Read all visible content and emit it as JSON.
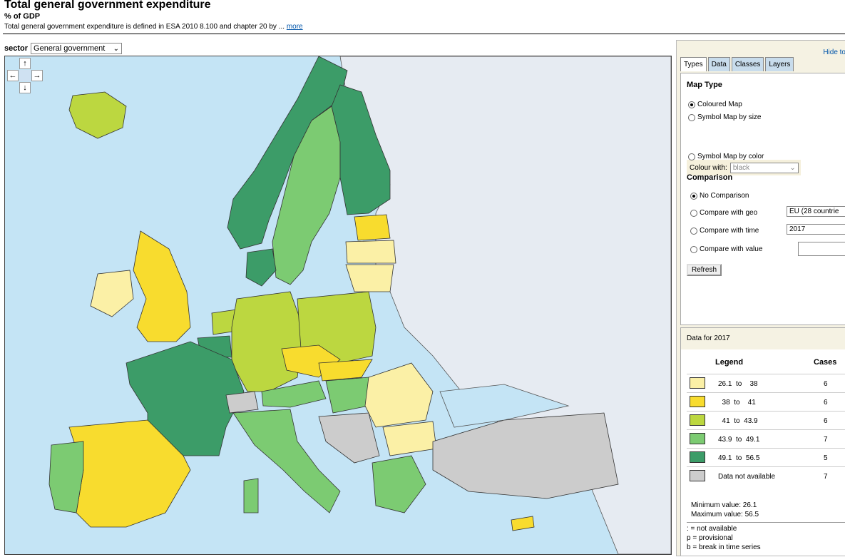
{
  "header": {
    "title": "Total general government expenditure",
    "unit": "% of GDP",
    "definition": "Total general government expenditure is defined in ESA 2010 8.100 and chapter 20 by ...",
    "more_link": "more"
  },
  "filter": {
    "label": "sector",
    "selected": "General government"
  },
  "map_nav": {
    "up": "↑",
    "down": "↓",
    "left": "←",
    "right": "→"
  },
  "sidepanel": {
    "hide_link": "Hide to",
    "tabs": [
      "Types",
      "Data",
      "Classes",
      "Layers"
    ],
    "active_tab": "Types",
    "map_type": {
      "heading": "Map Type",
      "coloured": "Coloured Map",
      "symbol_size": "Symbol Map by size",
      "colour_with_label": "Colour with:",
      "colour_with_value": "black",
      "symbol_color": "Symbol Map by color",
      "selected": "Coloured Map"
    },
    "comparison": {
      "heading": "Comparison",
      "none": "No Comparison",
      "geo": "Compare with geo",
      "geo_value": "EU (28 countrie",
      "time": "Compare with time",
      "time_value": "2017",
      "value": "Compare with value",
      "value_value": "",
      "selected": "No Comparison"
    },
    "refresh": "Refresh"
  },
  "legend": {
    "data_for": "Data for 2017",
    "title": "Legend",
    "cases_title": "Cases",
    "classes": [
      {
        "range": "26.1  to    38",
        "color": "#fbf0a6",
        "cases": "6"
      },
      {
        "range": "  38  to    41",
        "color": "#f8dc2e",
        "cases": "6"
      },
      {
        "range": "  41  to  43.9",
        "color": "#bcd740",
        "cases": "6"
      },
      {
        "range": "43.9  to  49.1",
        "color": "#7ccb72",
        "cases": "7"
      },
      {
        "range": "49.1  to  56.5",
        "color": "#3c9c68",
        "cases": "5"
      },
      {
        "range": "Data not available",
        "color": "#cccccc",
        "cases": "7"
      }
    ],
    "min": "Minimum value: 26.1",
    "max": "Maximum value: 56.5",
    "notes": [
      ": = not available",
      "p = provisional",
      "b = break in time series"
    ]
  },
  "colors": {
    "sea": "#c4e4f5",
    "non_eu": "#e6ebf2",
    "c1": "#fbf0a6",
    "c2": "#f8dc2e",
    "c3": "#bcd740",
    "c4": "#7ccb72",
    "c5": "#3c9c68",
    "na": "#cccccc"
  }
}
